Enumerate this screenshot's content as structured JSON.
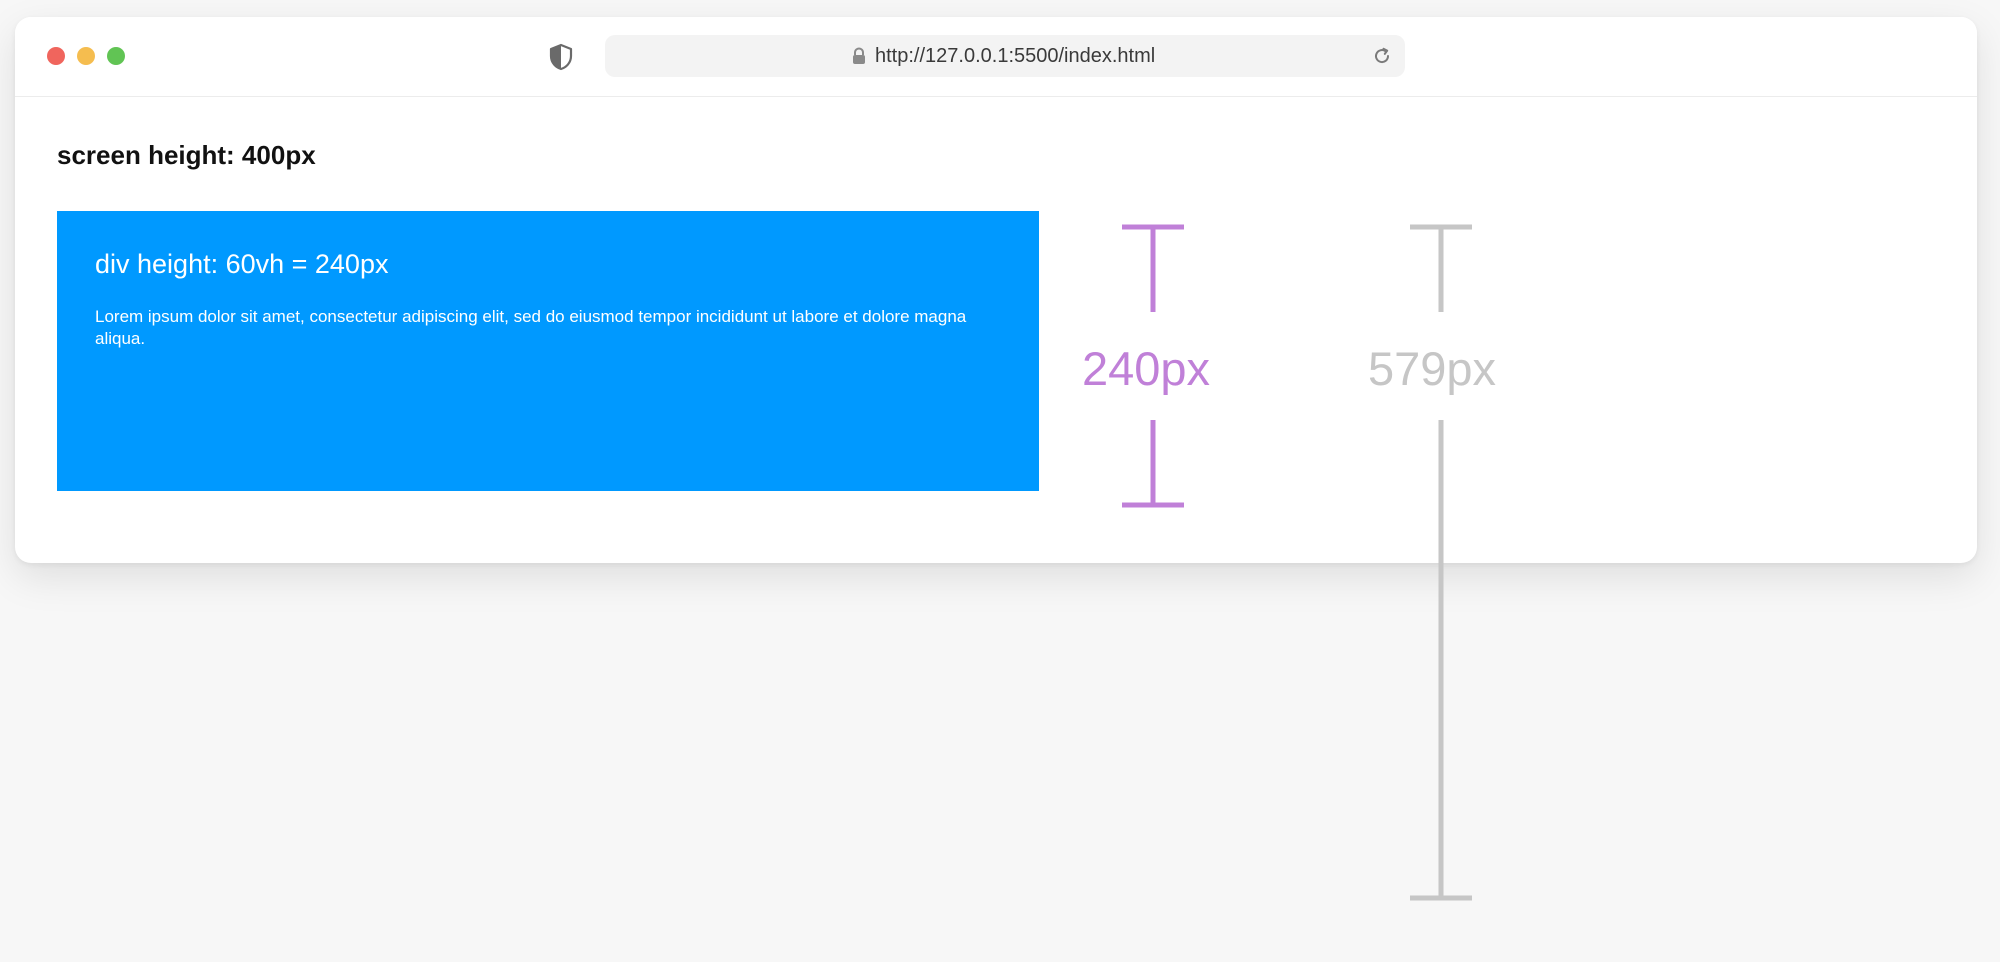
{
  "browser": {
    "url": "http://127.0.0.1:5500/index.html",
    "icons": {
      "shield": "shield-icon",
      "lock": "lock-icon",
      "reload": "reload-icon"
    }
  },
  "page": {
    "heading": "screen height: 400px",
    "box": {
      "title": "div height: 60vh = 240px",
      "text": "Lorem ipsum dolor sit amet, consectetur adipiscing elit, sed do eiusmod tempor incididunt ut labore et dolore magna aliqua.",
      "color": "#0099ff"
    }
  },
  "annotations": {
    "div_height": {
      "label": "240px",
      "color": "#c080d8"
    },
    "viewport_height": {
      "label": "579px",
      "color": "#c6c6c6"
    }
  }
}
